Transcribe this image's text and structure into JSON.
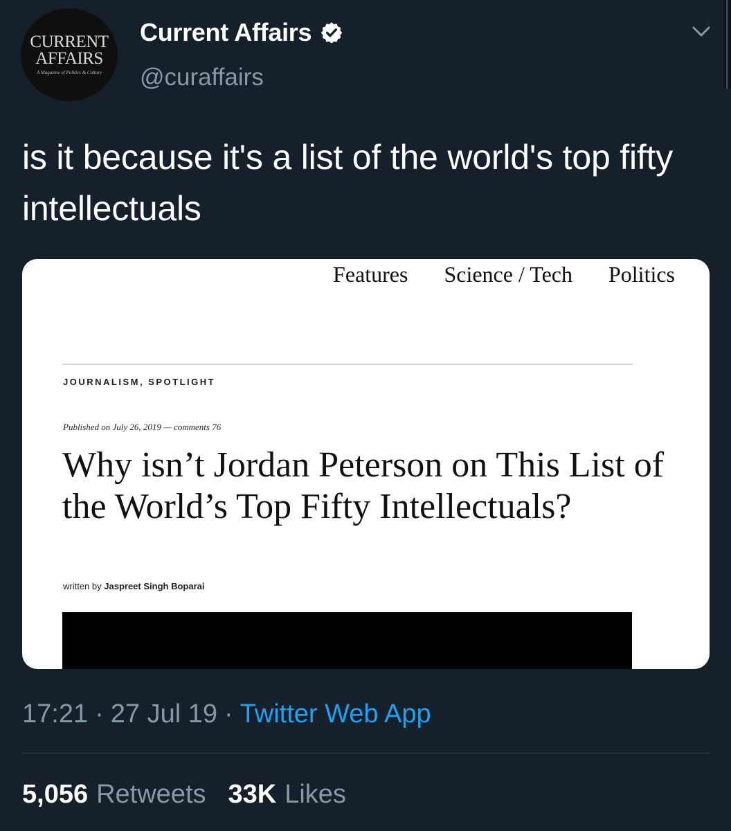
{
  "colors": {
    "background": "#15202b",
    "primary_text": "#ffffff",
    "secondary_text": "#8899a6",
    "link": "#1da1f2",
    "card_background": "#ffffff"
  },
  "author": {
    "avatar": {
      "line1": "CURRENT",
      "line2": "AFFAIRS",
      "tagline": "A Magazine of Politics & Culture"
    },
    "name": "Current Affairs",
    "handle": "@curaffairs",
    "verified": true
  },
  "tweet": {
    "text": "is it because it's a list of the world's top fifty intellectuals"
  },
  "card": {
    "nav": [
      "Features",
      "Science / Tech",
      "Politics"
    ],
    "category": "JOURNALISM, SPOTLIGHT",
    "published_prefix": "Published on",
    "published_date": "July 26, 2019",
    "comments_label": "comments 76",
    "headline": "Why isn’t Jordan Peterson on This List of the World’s Top Fifty Intellectuals?",
    "byline_prefix": "written by",
    "byline_author": "Jaspreet Singh Boparai"
  },
  "meta": {
    "time": "17:21",
    "date": "27 Jul 19",
    "separator": "·",
    "source": "Twitter Web App"
  },
  "stats": {
    "retweets_count": "5,056",
    "retweets_label": "Retweets",
    "likes_count": "33K",
    "likes_label": "Likes"
  }
}
